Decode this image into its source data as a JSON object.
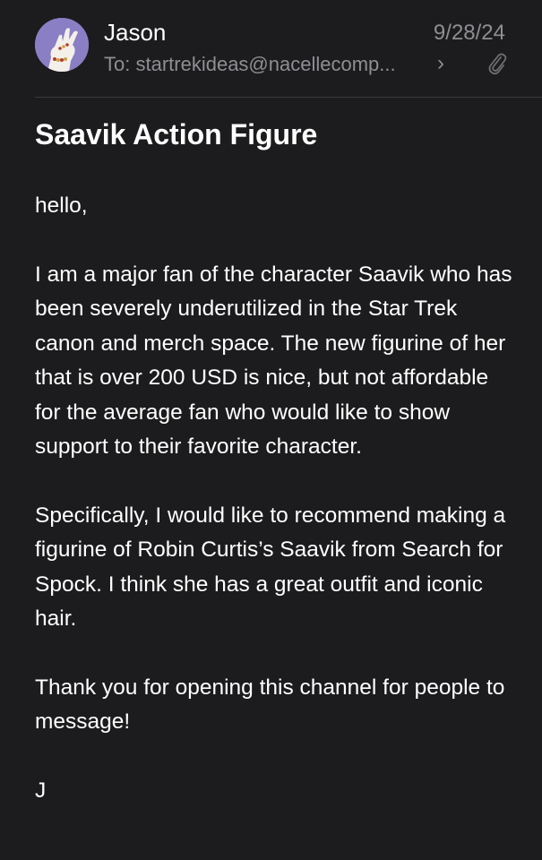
{
  "header": {
    "sender_name": "Jason",
    "date": "9/28/24",
    "to_label": "To:",
    "to_address": "startrekideas@nacellecomp...",
    "chevron": "›",
    "attachment_icon": "paperclip-icon",
    "avatar_icon": "hand-avatar"
  },
  "subject": "Saavik Action Figure",
  "body": {
    "paragraphs": [
      "hello,",
      "I am a major fan of the character Saavik who has been severely underutilized in the Star Trek canon and merch space. The new figurine of her that is over 200 USD is nice, but not affordable for the average fan who would like to show support to their favorite character.",
      "Specifically, I would like to recommend making a figurine of Robin Curtis’s Saavik from Search for Spock. I think she has a great outfit and iconic hair.",
      "Thank you for opening this channel for people to message!",
      "J"
    ]
  },
  "colors": {
    "background": "#1c1c1e",
    "text": "#ffffff",
    "secondary_text": "#8e8e93",
    "divider": "#3a3a3c",
    "avatar_bg": "#8a7fc4"
  }
}
